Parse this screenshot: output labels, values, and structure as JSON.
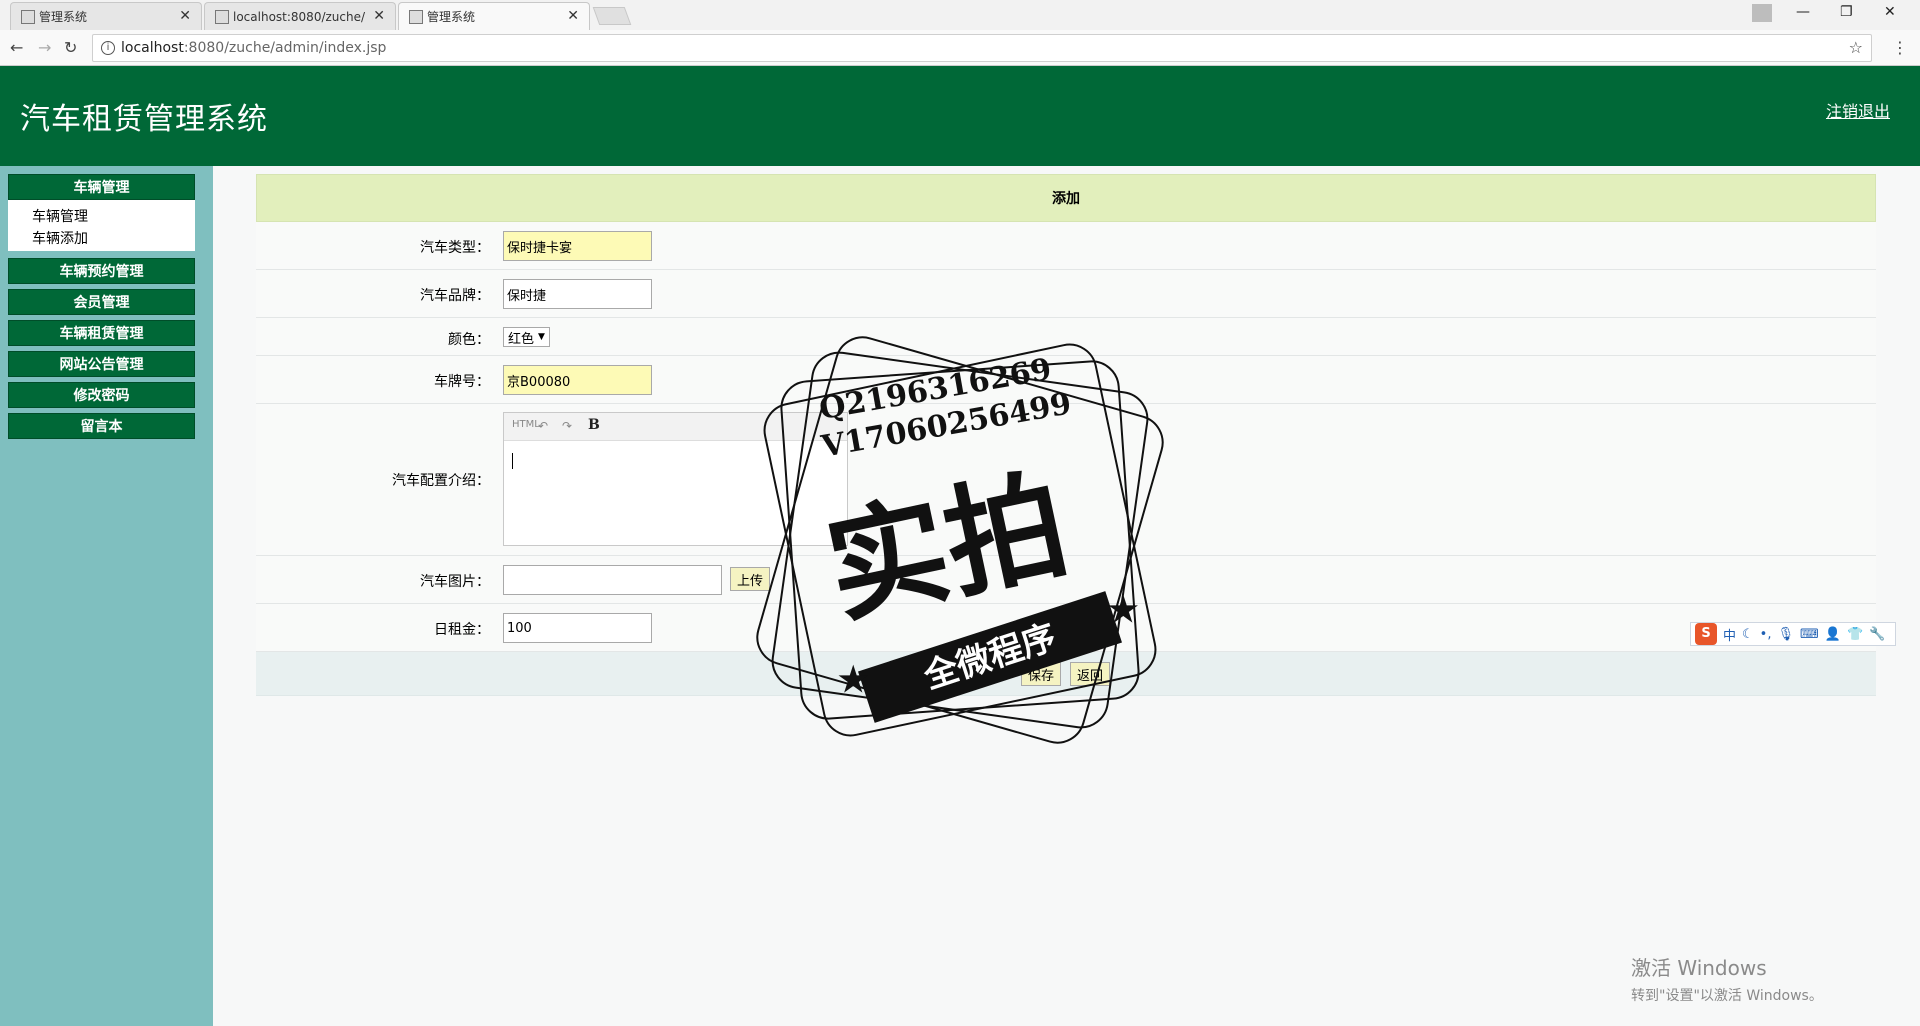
{
  "browser": {
    "tabs": [
      {
        "label": "管理系统"
      },
      {
        "label": "localhost:8080/zuche/"
      },
      {
        "label": "管理系统"
      }
    ],
    "url_host": "localhost",
    "url_path": ":8080/zuche/admin/index.jsp"
  },
  "header": {
    "title": "汽车租赁管理系统",
    "logout": "注销退出"
  },
  "sidebar": {
    "menus": [
      {
        "label": "车辆管理",
        "subitems": [
          "车辆管理",
          "车辆添加"
        ]
      },
      {
        "label": "车辆预约管理"
      },
      {
        "label": "会员管理"
      },
      {
        "label": "车辆租赁管理"
      },
      {
        "label": "网站公告管理"
      },
      {
        "label": "修改密码"
      },
      {
        "label": "留言本"
      }
    ]
  },
  "form": {
    "title": "添加",
    "car_type": {
      "label": "汽车类型：",
      "value": "保时捷卡宴"
    },
    "car_brand": {
      "label": "汽车品牌：",
      "value": "保时捷"
    },
    "color": {
      "label": "颜色：",
      "value": "红色"
    },
    "plate": {
      "label": "车牌号：",
      "value": "京B00080"
    },
    "config": {
      "label": "汽车配置介绍：",
      "toolbar_html": "HTML",
      "toolbar_bold": "B"
    },
    "image": {
      "label": "汽车图片：",
      "upload_label": "上传"
    },
    "daily_rent": {
      "label": "日租金：",
      "value": "100"
    },
    "save_label": "保存",
    "back_label": "返回"
  },
  "watermark": {
    "qq": "Q2196316269",
    "wx": "V17060256499",
    "big": "实拍",
    "banner": "全微程序"
  },
  "ime": {
    "label": "中"
  },
  "activation": {
    "line1": "激活 Windows",
    "line2": "转到\"设置\"以激活 Windows。"
  }
}
